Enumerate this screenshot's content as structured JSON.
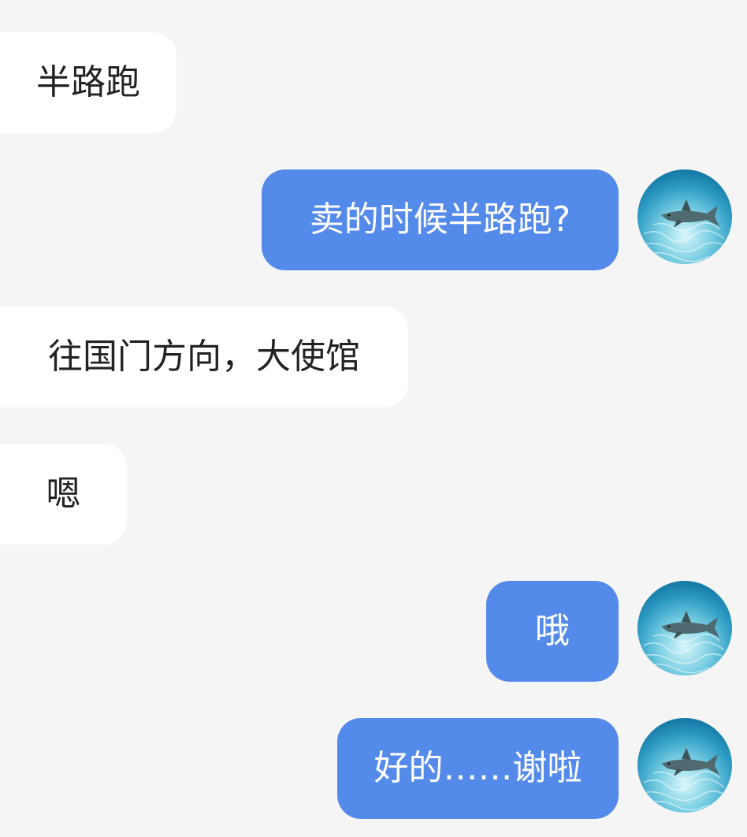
{
  "conversation": {
    "messages": [
      {
        "sender": "other",
        "text": "半路跑"
      },
      {
        "sender": "me",
        "text": "卖的时候半路跑?"
      },
      {
        "sender": "other",
        "text": "往国门方向，大使馆"
      },
      {
        "sender": "other",
        "text": "嗯"
      },
      {
        "sender": "me",
        "text": "哦"
      },
      {
        "sender": "me",
        "text": "好的……谢啦"
      }
    ]
  },
  "colors": {
    "background": "#f5f5f5",
    "incoming_bubble": "#ffffff",
    "outgoing_bubble": "#548aea",
    "incoming_text": "#222222",
    "outgoing_text": "#ffffff"
  },
  "icons": {
    "my_avatar": "shark-underwater-avatar"
  }
}
